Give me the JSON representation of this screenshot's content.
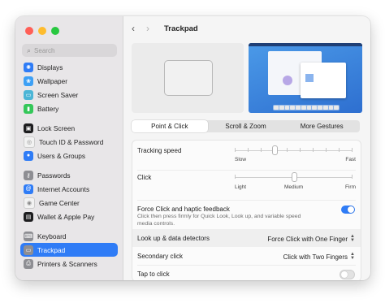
{
  "search": {
    "placeholder": "Search"
  },
  "sidebar": {
    "items": [
      {
        "label": "Displays",
        "icon": "displays-icon",
        "color": "#2f7cf6",
        "glyph": "✺"
      },
      {
        "label": "Wallpaper",
        "icon": "wallpaper-icon",
        "color": "#3da0f5",
        "glyph": "❀"
      },
      {
        "label": "Screen Saver",
        "icon": "screen-saver-icon",
        "color": "#4bb5d6",
        "glyph": "▭"
      },
      {
        "label": "Battery",
        "icon": "battery-icon",
        "color": "#34c759",
        "glyph": "▮"
      },
      {
        "label": "Lock Screen",
        "icon": "lock-icon",
        "color": "#1d1d1f",
        "glyph": "▣"
      },
      {
        "label": "Touch ID & Password",
        "icon": "fingerprint-icon",
        "color": "#f2f2f2",
        "glyph": "◎"
      },
      {
        "label": "Users & Groups",
        "icon": "users-icon",
        "color": "#2f7cf6",
        "glyph": "●"
      },
      {
        "label": "Passwords",
        "icon": "key-icon",
        "color": "#8e8e93",
        "glyph": "⚷"
      },
      {
        "label": "Internet Accounts",
        "icon": "at-sign-icon",
        "color": "#2f7cf6",
        "glyph": "@"
      },
      {
        "label": "Game Center",
        "icon": "game-center-icon",
        "color": "#f2f2f2",
        "glyph": "◉"
      },
      {
        "label": "Wallet & Apple Pay",
        "icon": "wallet-icon",
        "color": "#1d1d1f",
        "glyph": "▤"
      },
      {
        "label": "Keyboard",
        "icon": "keyboard-icon",
        "color": "#8e8e93",
        "glyph": "⌨"
      },
      {
        "label": "Trackpad",
        "icon": "trackpad-icon",
        "color": "#8e8e93",
        "glyph": "▭"
      },
      {
        "label": "Printers & Scanners",
        "icon": "printer-icon",
        "color": "#8e8e93",
        "glyph": "⎙"
      }
    ]
  },
  "header": {
    "title": "Trackpad"
  },
  "tabs": [
    {
      "label": "Point & Click"
    },
    {
      "label": "Scroll & Zoom"
    },
    {
      "label": "More Gestures"
    }
  ],
  "settings": {
    "tracking_speed": {
      "label": "Tracking speed",
      "min_label": "Slow",
      "max_label": "Fast",
      "level": 0.33
    },
    "click": {
      "label": "Click",
      "min_label": "Light",
      "mid_label": "Medium",
      "max_label": "Firm",
      "level": 0.5
    },
    "force_click": {
      "label": "Force Click and haptic feedback",
      "description": "Click then press firmly for Quick Look, Look up, and variable speed media controls.",
      "on": true
    },
    "look_up": {
      "label": "Look up & data detectors",
      "value": "Force Click with One Finger"
    },
    "secondary_click": {
      "label": "Secondary click",
      "value": "Click with Two Fingers"
    },
    "tap_to_click": {
      "label": "Tap to click",
      "on": false
    }
  }
}
